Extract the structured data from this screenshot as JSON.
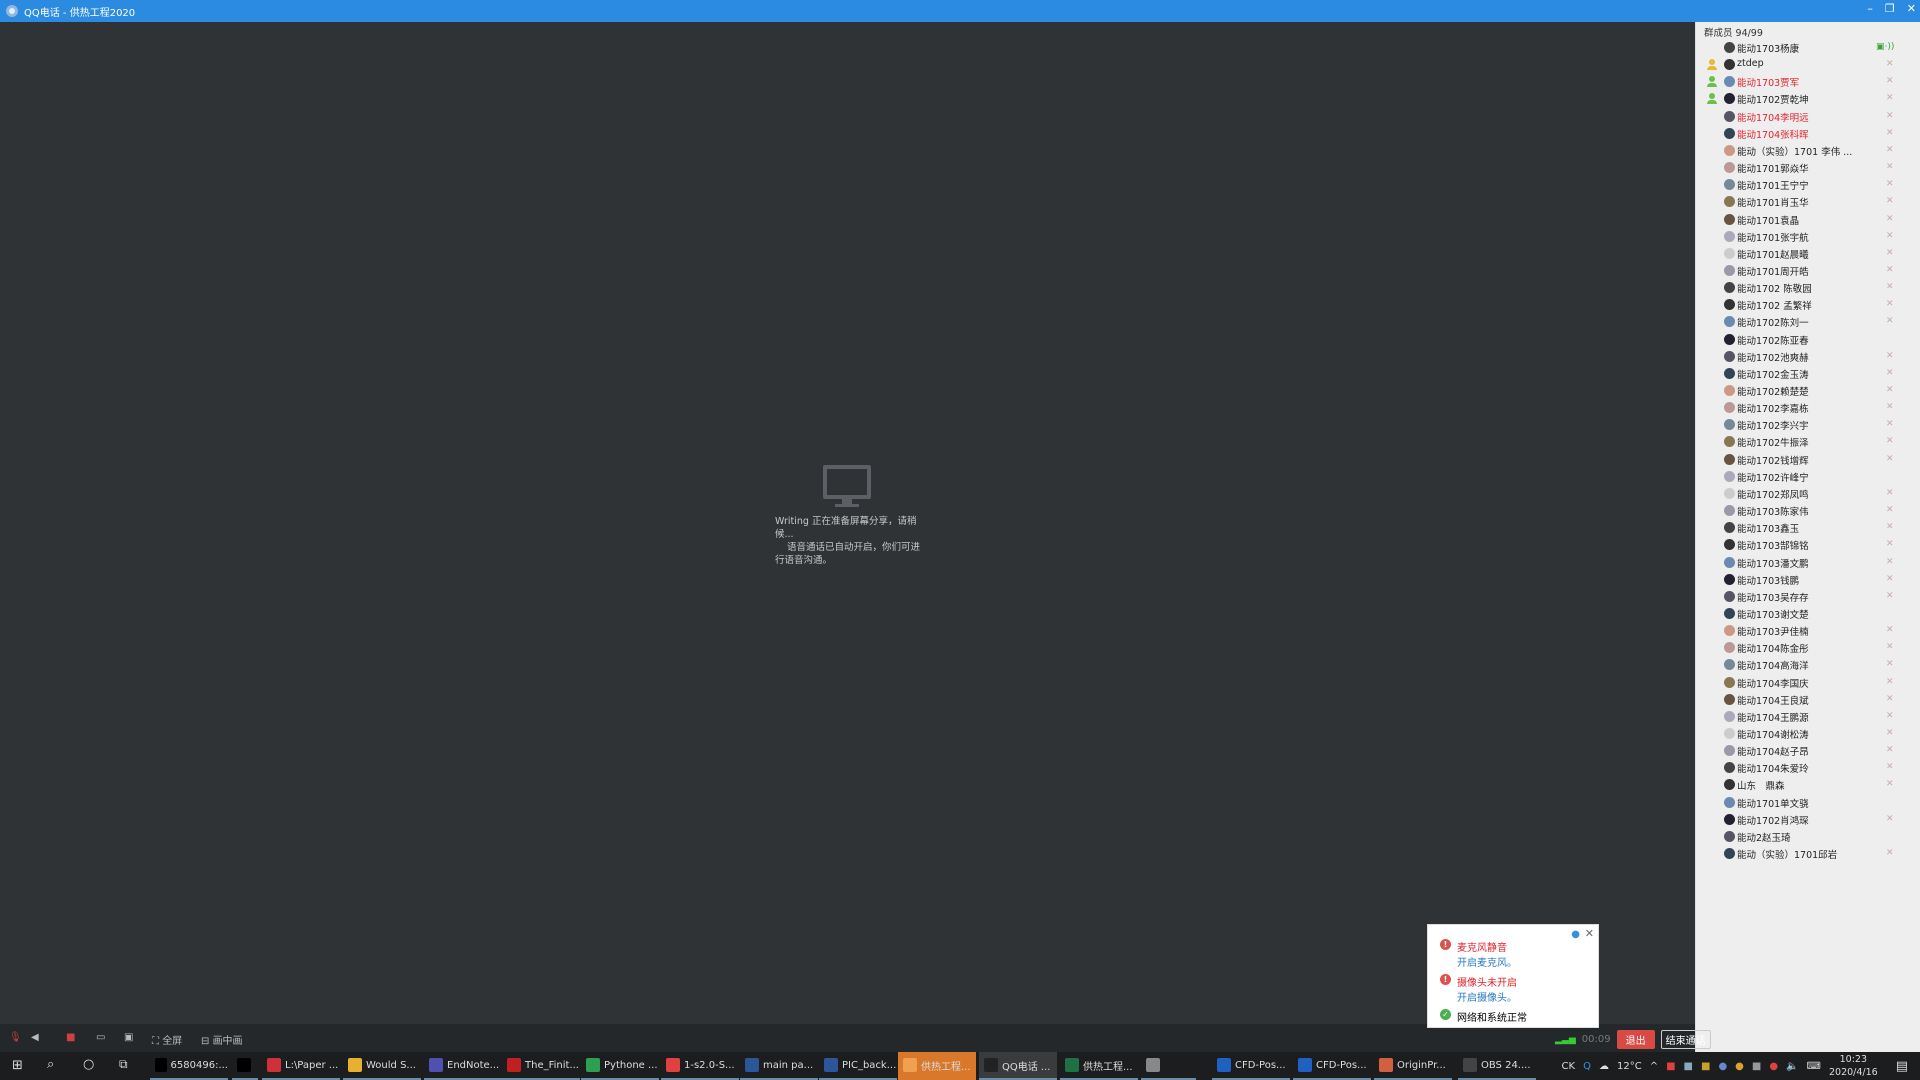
{
  "window": {
    "title": "QQ电话 - 供热工程2020",
    "controls": [
      "–",
      "❐",
      "✕"
    ]
  },
  "share": {
    "line1": "Writing 正在准备屏幕分享，请稍候...",
    "line2": "语音通话已自动开启，你们可进行语音沟通。"
  },
  "members": {
    "header": "群成员 94/99",
    "list": [
      {
        "name": "能动1703杨康",
        "sharing": true
      },
      {
        "name": "ztdep",
        "role": "owner",
        "mic": true
      },
      {
        "name": "能动1703贾军",
        "red": true,
        "role": "admin",
        "mic": true
      },
      {
        "name": "能动1702贾乾坤",
        "role": "admin",
        "mic": true
      },
      {
        "name": "能动1704李明远",
        "red": true,
        "mic": true
      },
      {
        "name": "能动1704张科晖",
        "red": true,
        "mic": true
      },
      {
        "name": "能动（实验）1701 李伟 ...",
        "mic": true
      },
      {
        "name": "能动1701郭焱华",
        "mic": true
      },
      {
        "name": "能动1701王宁宁",
        "mic": true
      },
      {
        "name": "能动1701肖玉华",
        "mic": true
      },
      {
        "name": "能动1701袁晶",
        "mic": true
      },
      {
        "name": "能动1701张宇航",
        "mic": true
      },
      {
        "name": "能动1701赵晨曦",
        "mic": true
      },
      {
        "name": "能动1701周开皓",
        "mic": true
      },
      {
        "name": "能动1702 陈敬园",
        "mic": true
      },
      {
        "name": "能动1702 孟繁祥",
        "mic": true
      },
      {
        "name": "能动1702陈刘一",
        "mic": true
      },
      {
        "name": "能动1702陈亚春"
      },
      {
        "name": "能动1702池爽赫",
        "mic": true
      },
      {
        "name": "能动1702金玉涛",
        "mic": true
      },
      {
        "name": "能动1702赖楚楚",
        "mic": true
      },
      {
        "name": "能动1702李嘉栋",
        "mic": true
      },
      {
        "name": "能动1702李兴宇",
        "mic": true
      },
      {
        "name": "能动1702牛振泽",
        "mic": true
      },
      {
        "name": "能动1702钱增辉",
        "mic": true
      },
      {
        "name": "能动1702许峰宁"
      },
      {
        "name": "能动1702郑凤鸣",
        "mic": true
      },
      {
        "name": "能动1703陈家伟",
        "mic": true
      },
      {
        "name": "能动1703鑫玉",
        "mic": true
      },
      {
        "name": "能动1703郜锦铭",
        "mic": true
      },
      {
        "name": "能动1703潘文鹏",
        "mic": true
      },
      {
        "name": "能动1703钱鹏",
        "mic": true
      },
      {
        "name": "能动1703吴存存",
        "mic": true
      },
      {
        "name": "能动1703谢文楚"
      },
      {
        "name": "能动1703尹佳楠",
        "mic": true
      },
      {
        "name": "能动1704陈金彤",
        "mic": true
      },
      {
        "name": "能动1704高海洋",
        "mic": true
      },
      {
        "name": "能动1704李国庆",
        "mic": true
      },
      {
        "name": "能动1704王良斌",
        "mic": true
      },
      {
        "name": "能动1704王鹏源",
        "mic": true
      },
      {
        "name": "能动1704谢松涛",
        "mic": true
      },
      {
        "name": "能动1704赵子昂",
        "mic": true
      },
      {
        "name": "能动1704朱爱玲",
        "mic": true
      },
      {
        "name": "山东　鼎森",
        "mic": true
      },
      {
        "name": "能动1701单文骁"
      },
      {
        "name": "能动1702肖鸿琛",
        "mic": true
      },
      {
        "name": "能动2赵玉琦"
      },
      {
        "name": "能动（实验）1701邱岩",
        "mic": true
      }
    ]
  },
  "toolbar": {
    "fullscreen": "全屏",
    "pip": "画中画"
  },
  "popup": {
    "mic_title": "麦克风静音",
    "mic_action": "开启麦克风。",
    "cam_title": "摄像头未开启",
    "cam_action": "开启摄像头。",
    "network": "网络和系统正常"
  },
  "call": {
    "duration": "00:09",
    "exit": "退出",
    "end": "结束通话"
  },
  "taskbar": {
    "apps": [
      {
        "label": "6580496:...",
        "color": "#000"
      },
      {
        "label": "",
        "color": "#000"
      },
      {
        "label": "L:\\Paper ...",
        "color": "#d0303a"
      },
      {
        "label": "Would S...",
        "color": "#e8b030"
      },
      {
        "label": "EndNote...",
        "color": "#5050b0"
      },
      {
        "label": "The_Finit...",
        "color": "#c02020"
      },
      {
        "label": "Pythone ...",
        "color": "#2aa050"
      },
      {
        "label": "1-s2.0-S...",
        "color": "#e04040"
      },
      {
        "label": "main pa...",
        "color": "#2b579a"
      },
      {
        "label": "PIC_back...",
        "color": "#2b579a"
      },
      {
        "label": "供热工程...",
        "color": "#f0a050",
        "active": true
      },
      {
        "label": "QQ电话 ...",
        "color": "#222",
        "qq": true
      },
      {
        "label": "供热工程...",
        "color": "#1e7145"
      },
      {
        "label": "",
        "color": "#888"
      },
      {
        "label": "CFD-Pos...",
        "color": "#2060c0"
      },
      {
        "label": "CFD-Pos...",
        "color": "#2060c0"
      },
      {
        "label": "OriginPr...",
        "color": "#d06040"
      },
      {
        "label": "OBS 24....",
        "color": "#444"
      }
    ],
    "ime": "CK",
    "weather": "12°C",
    "time": "10:23",
    "date": "2020/4/16"
  }
}
